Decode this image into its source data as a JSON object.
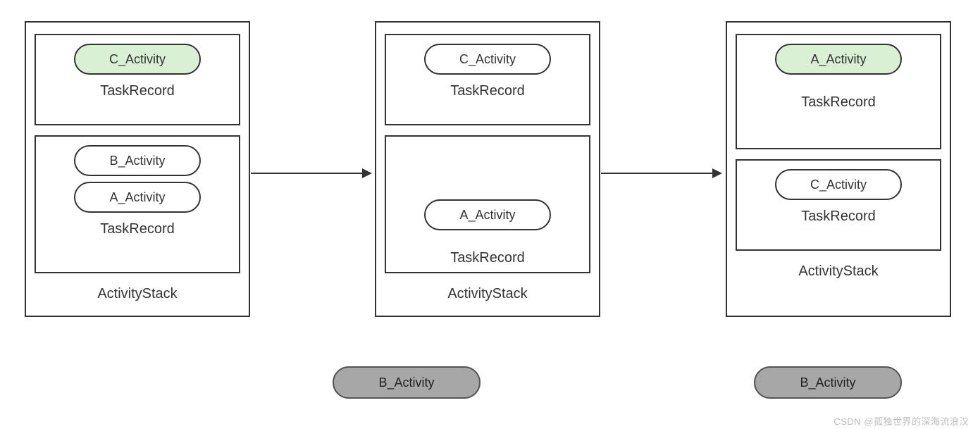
{
  "labels": {
    "activity_stack": "ActivityStack",
    "task_record": "TaskRecord"
  },
  "activities": {
    "a": "A_Activity",
    "b": "B_Activity",
    "c": "C_Activity"
  },
  "watermark": "CSDN @孤独世界的深海流浪汉",
  "chart_data": {
    "type": "diagram",
    "description": "Android ActivityStack/TaskRecord state transitions across three steps with removed B_Activity instances shown below.",
    "nodes": [
      {
        "id": "stack1",
        "type": "ActivityStack",
        "tasks": [
          {
            "type": "TaskRecord",
            "activities": [
              {
                "name": "C_Activity",
                "highlighted": true
              }
            ]
          },
          {
            "type": "TaskRecord",
            "activities": [
              {
                "name": "B_Activity"
              },
              {
                "name": "A_Activity"
              }
            ]
          }
        ]
      },
      {
        "id": "stack2",
        "type": "ActivityStack",
        "tasks": [
          {
            "type": "TaskRecord",
            "activities": [
              {
                "name": "C_Activity"
              }
            ]
          },
          {
            "type": "TaskRecord",
            "activities": [
              {
                "name": "A_Activity"
              }
            ]
          }
        ]
      },
      {
        "id": "stack3",
        "type": "ActivityStack",
        "tasks": [
          {
            "type": "TaskRecord",
            "activities": [
              {
                "name": "A_Activity",
                "highlighted": true
              }
            ]
          },
          {
            "type": "TaskRecord",
            "activities": [
              {
                "name": "C_Activity"
              }
            ]
          }
        ]
      }
    ],
    "floating": [
      {
        "name": "B_Activity",
        "below": "stack2"
      },
      {
        "name": "B_Activity",
        "below": "stack3"
      }
    ],
    "edges": [
      {
        "from": "stack1",
        "to": "stack2"
      },
      {
        "from": "stack2",
        "to": "stack3"
      }
    ]
  }
}
